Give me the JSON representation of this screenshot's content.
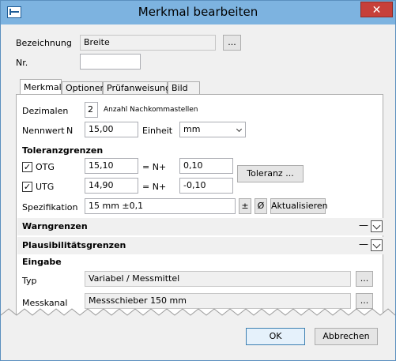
{
  "window": {
    "title": "Merkmal bearbeiten",
    "close_glyph": "✕"
  },
  "form": {
    "bezeichnung_label": "Bezeichnung",
    "bezeichnung_value": "Breite",
    "bezeichnung_btn": "...",
    "nr_label": "Nr.",
    "nr_value": ""
  },
  "tabs": [
    {
      "label": "Merkmal"
    },
    {
      "label": "Optionen"
    },
    {
      "label": "Prüfanweisung"
    },
    {
      "label": "Bild"
    }
  ],
  "merkmal": {
    "dezimalen_label": "Dezimalen",
    "dezimalen_value": "2",
    "dezimalen_hint": "Anzahl Nachkommastellen",
    "nennwert_label": "Nennwert",
    "nennwert_symbol": "N",
    "nennwert_value": "15,00",
    "einheit_label": "Einheit",
    "einheit_value": "mm",
    "toleranz_title": "Toleranzgrenzen",
    "otg_label": "OTG",
    "otg_checked": true,
    "otg_value": "15,10",
    "otg_formula": "= N+",
    "otg_offset": "0,10",
    "utg_label": "UTG",
    "utg_checked": true,
    "utg_value": "14,90",
    "utg_formula": "= N+",
    "utg_offset": "-0,10",
    "toleranz_btn": "Toleranz ...",
    "spezifikation_label": "Spezifikation",
    "spezifikation_value": "15 mm ±0,1",
    "pm_btn": "±",
    "diam_btn": "Ø",
    "aktualisieren_btn": "Aktualisieren",
    "warngrenzen_title": "Warngrenzen",
    "plausibilitaet_title": "Plausibilitätsgrenzen",
    "collapse_glyph": "—",
    "eingabe_title": "Eingabe",
    "typ_label": "Typ",
    "typ_value": "Variabel / Messmittel",
    "typ_btn": "...",
    "messkanal_label": "Messkanal",
    "messkanal_value": "Messschieber 150 mm",
    "messkanal_btn": "..."
  },
  "footer": {
    "ok_label": "OK",
    "cancel_label": "Abbrechen"
  }
}
